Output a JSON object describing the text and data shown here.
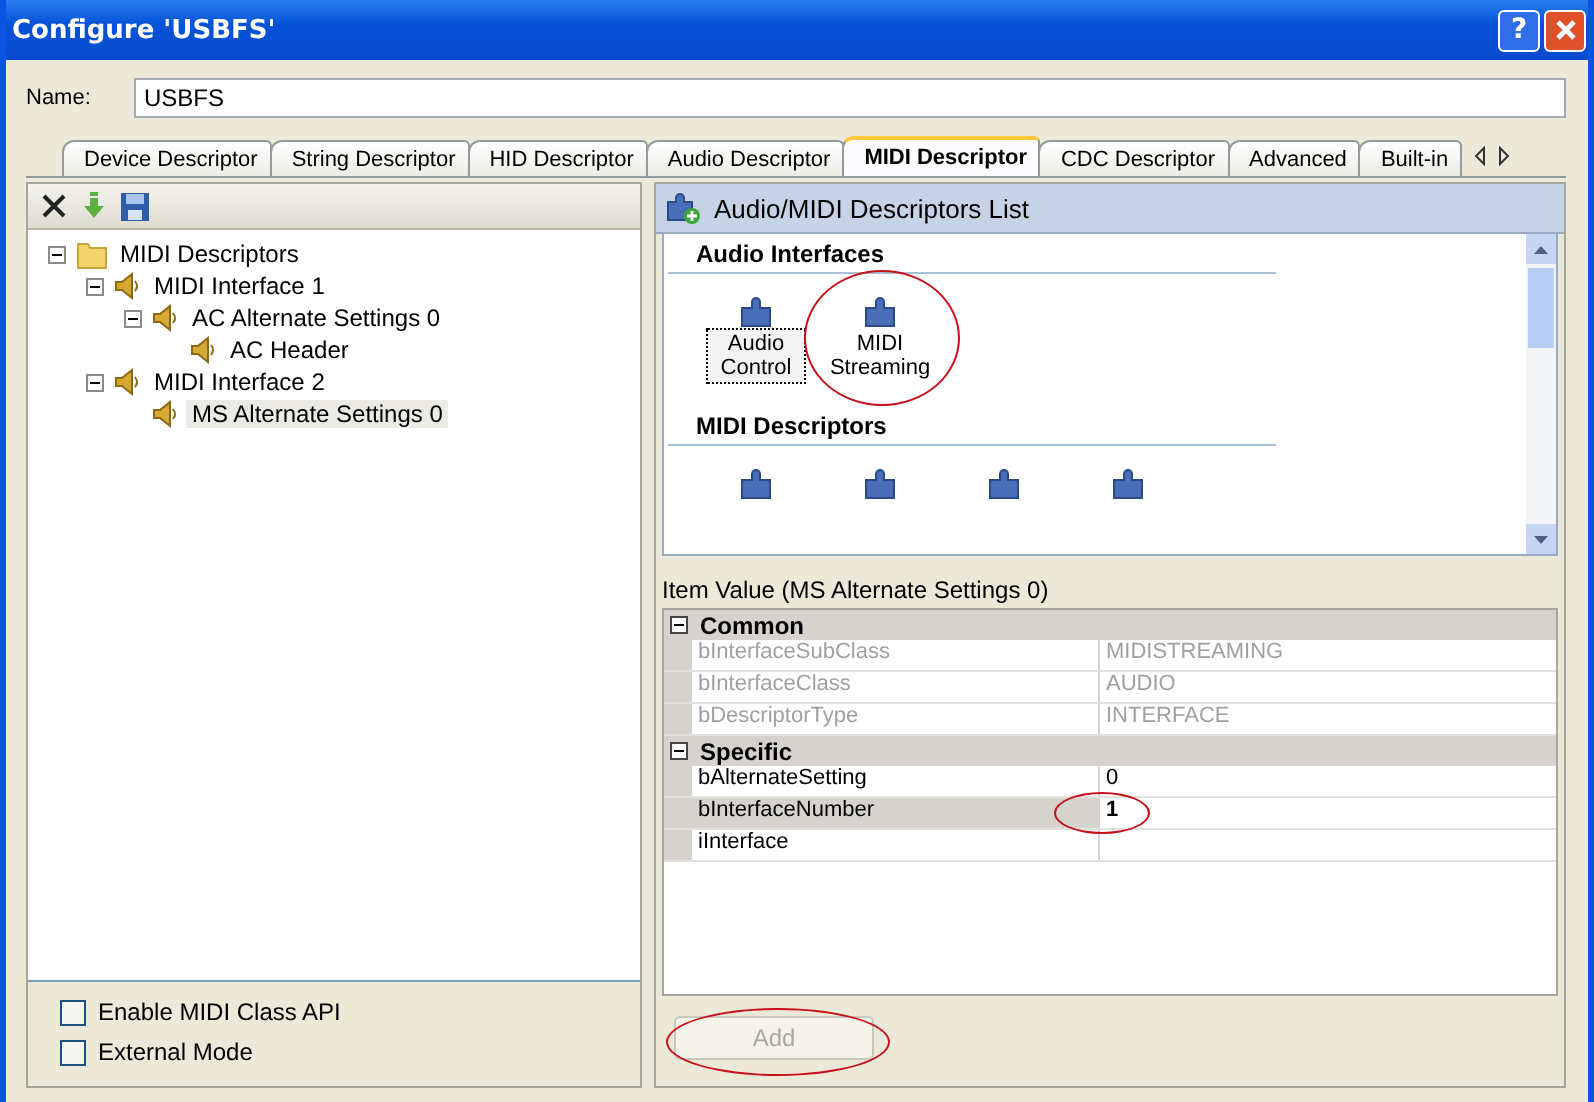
{
  "window": {
    "title": "Configure 'USBFS'",
    "help": "?"
  },
  "name_field": {
    "label": "Name:",
    "value": "USBFS"
  },
  "tabs": [
    {
      "label": "Device Descriptor",
      "selected": false
    },
    {
      "label": "String Descriptor",
      "selected": false
    },
    {
      "label": "HID Descriptor",
      "selected": false
    },
    {
      "label": "Audio Descriptor",
      "selected": false
    },
    {
      "label": "MIDI Descriptor",
      "selected": true
    },
    {
      "label": "CDC Descriptor",
      "selected": false
    },
    {
      "label": "Advanced",
      "selected": false
    },
    {
      "label": "Built-in",
      "selected": false
    }
  ],
  "tree": [
    {
      "label": "MIDI Descriptors",
      "kind": "folder",
      "expanded": true,
      "selected": false,
      "children": [
        {
          "label": "MIDI Interface 1",
          "kind": "speaker",
          "expanded": true,
          "selected": false,
          "children": [
            {
              "label": "AC Alternate Settings 0",
              "kind": "speaker",
              "expanded": true,
              "selected": false,
              "children": [
                {
                  "label": "AC Header",
                  "kind": "speaker",
                  "selected": false
                }
              ]
            }
          ]
        },
        {
          "label": "MIDI Interface 2",
          "kind": "speaker",
          "expanded": true,
          "selected": false,
          "children": [
            {
              "label": "MS Alternate Settings 0",
              "kind": "speaker",
              "selected": true
            }
          ]
        }
      ]
    }
  ],
  "options": [
    {
      "label": "Enable MIDI Class API",
      "checked": false
    },
    {
      "label": "External Mode",
      "checked": false
    }
  ],
  "descriptor_list": {
    "title": "Audio/MIDI Descriptors List",
    "sections": [
      {
        "heading": "Audio Interfaces",
        "items": [
          {
            "kind": "puzzle",
            "label": "Audio Control",
            "focused": true,
            "circled": false
          },
          {
            "kind": "puzzle",
            "label": "MIDI Streaming",
            "focused": false,
            "circled": true
          }
        ]
      },
      {
        "heading": "MIDI Descriptors",
        "items": [
          {
            "kind": "puzzle"
          },
          {
            "kind": "puzzle"
          },
          {
            "kind": "puzzle"
          },
          {
            "kind": "puzzle"
          }
        ]
      }
    ]
  },
  "item_value": {
    "title": "Item Value (MS Alternate Settings 0)",
    "categories": [
      {
        "name": "Common",
        "expanded": true,
        "rows": [
          {
            "name": "bInterfaceSubClass",
            "value": "MIDISTREAMING",
            "disabled": true,
            "selected": false,
            "circled": false
          },
          {
            "name": "bInterfaceClass",
            "value": "AUDIO",
            "disabled": true,
            "selected": false,
            "circled": false
          },
          {
            "name": "bDescriptorType",
            "value": "INTERFACE",
            "disabled": true,
            "selected": false,
            "circled": false
          }
        ]
      },
      {
        "name": "Specific",
        "expanded": true,
        "rows": [
          {
            "name": "bAlternateSetting",
            "value": "0",
            "disabled": false,
            "selected": false,
            "circled": false
          },
          {
            "name": "bInterfaceNumber",
            "value": "1",
            "disabled": false,
            "selected": true,
            "circled": true
          },
          {
            "name": "iInterface",
            "disabled": false,
            "selected": false,
            "circled": false
          }
        ]
      }
    ]
  },
  "add_button": {
    "label": "Add",
    "disabled": true,
    "circled": true
  }
}
